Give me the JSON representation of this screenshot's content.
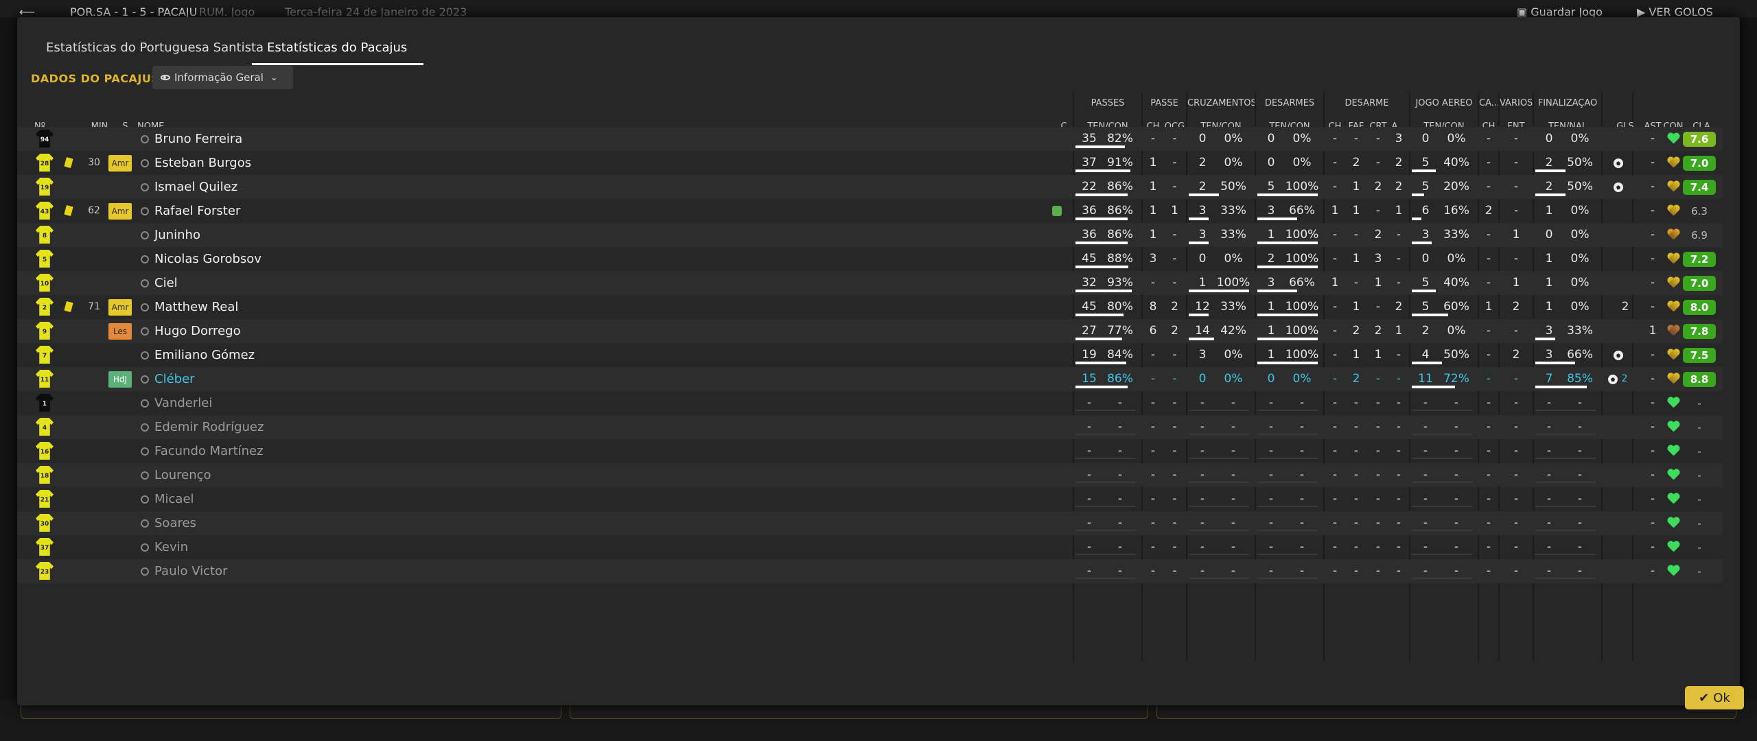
{
  "background": {
    "match_info": "POR.SA - 1 - 5 - PACAJU",
    "match_extra": "RUM. Jogo",
    "date": "Terça-feira 24 de Janeiro de 2023",
    "save_label": "Guardar Jogo",
    "view_label": "VER GOLOS"
  },
  "tabs": [
    {
      "label": "Estatísticas do Portuguesa Santista",
      "active": false
    },
    {
      "label": "Estatísticas do Pacajus",
      "active": true
    }
  ],
  "team_label": "DADOS DO PACAJUS",
  "view_dropdown": {
    "label": "Informação Geral"
  },
  "group_headers": {
    "passes": "PASSES",
    "passe": "PASSE",
    "cruzamentos": "CRUZAMENTOS",
    "desarmes": "DESARMES",
    "desarme": "DESARME",
    "jogo_aereo": "JOGO AÉREO",
    "ca": "CA...",
    "varios": "VÁRIOS",
    "finalizacao": "FINALIZAÇÃO"
  },
  "columns": {
    "num": "Nº",
    "min": "MIN",
    "s": "S",
    "nome": "NOME",
    "c": "C",
    "passes": "TEN/CON",
    "passe_ch": "CH",
    "passe_ocg": "OCG",
    "cruz": "TEN/CON",
    "desarmes": "TEN/CON",
    "des_ch": "CH",
    "des_faf": "FAF",
    "des_crt": "CRT",
    "des_a": "A...",
    "aereo": "TEN/CON",
    "ca_ch": "CH",
    "fnt": "FNT",
    "fin": "TEN/NAL",
    "gls": "GLS",
    "ast": "AST",
    "con": "CON",
    "cla": "CLA"
  },
  "colors": {
    "accent": "#e0b52b",
    "highlight": "#3ec6e8",
    "rating_green": "#3aa71e"
  },
  "players": [
    {
      "num": "94",
      "gk": true,
      "card": false,
      "min": "",
      "badge": "",
      "name": "Bruno Ferreira",
      "sub": false,
      "pass": [
        "35",
        "82%",
        0.82
      ],
      "pch": "-",
      "pocg": "-",
      "cruz": [
        "0",
        "0%",
        0
      ],
      "des": [
        "0",
        "0%",
        0
      ],
      "dch": "-",
      "faf": "-",
      "crt": "-",
      "da": "3",
      "aer": [
        "0",
        "0%",
        0
      ],
      "cach": "-",
      "fnt": "-",
      "fin": [
        "0",
        "0%",
        0
      ],
      "gls": "",
      "ast": "-",
      "con": "green",
      "cla": "7.6",
      "cla_style": "lg",
      "unused": false,
      "hl": false
    },
    {
      "num": "28",
      "gk": false,
      "card": true,
      "min": "30",
      "badge": "Amr",
      "name": "Esteban Burgos",
      "sub": false,
      "pass": [
        "37",
        "91%",
        0.91
      ],
      "pch": "1",
      "pocg": "-",
      "cruz": [
        "2",
        "0%",
        0
      ],
      "des": [
        "0",
        "0%",
        0
      ],
      "dch": "-",
      "faf": "2",
      "crt": "-",
      "da": "2",
      "aer": [
        "5",
        "40%",
        0.4
      ],
      "cach": "-",
      "fnt": "-",
      "fin": [
        "2",
        "50%",
        0.5
      ],
      "gls": "ball",
      "ast": "-",
      "con": "gold",
      "cla": "7.0",
      "cla_style": "g",
      "unused": false,
      "hl": false
    },
    {
      "num": "19",
      "gk": false,
      "card": false,
      "min": "",
      "badge": "",
      "name": "Ismael Quilez",
      "sub": false,
      "pass": [
        "22",
        "86%",
        0.86
      ],
      "pch": "1",
      "pocg": "-",
      "cruz": [
        "2",
        "50%",
        0.5
      ],
      "des": [
        "5",
        "100%",
        1
      ],
      "dch": "-",
      "faf": "1",
      "crt": "2",
      "da": "2",
      "aer": [
        "5",
        "20%",
        0.2
      ],
      "cach": "-",
      "fnt": "-",
      "fin": [
        "2",
        "50%",
        0.5
      ],
      "gls": "ball",
      "ast": "-",
      "con": "gold",
      "cla": "7.4",
      "cla_style": "g",
      "unused": false,
      "hl": false
    },
    {
      "num": "43",
      "gk": false,
      "card": true,
      "min": "62",
      "badge": "Amr",
      "name": "Rafael Forster",
      "sub": true,
      "pass": [
        "36",
        "86%",
        0.86
      ],
      "pch": "1",
      "pocg": "1",
      "cruz": [
        "3",
        "33%",
        0.33
      ],
      "des": [
        "3",
        "66%",
        0.66
      ],
      "dch": "1",
      "faf": "1",
      "crt": "-",
      "da": "1",
      "aer": [
        "6",
        "16%",
        0.16
      ],
      "cach": "2",
      "fnt": "-",
      "fin": [
        "1",
        "0%",
        0
      ],
      "gls": "",
      "ast": "-",
      "con": "gold",
      "cla": "6.3",
      "cla_style": "n",
      "unused": false,
      "hl": false
    },
    {
      "num": "8",
      "gk": false,
      "card": false,
      "min": "",
      "badge": "",
      "name": "Juninho",
      "sub": false,
      "pass": [
        "36",
        "86%",
        0.86
      ],
      "pch": "1",
      "pocg": "-",
      "cruz": [
        "3",
        "33%",
        0.33
      ],
      "des": [
        "1",
        "100%",
        1
      ],
      "dch": "-",
      "faf": "-",
      "crt": "2",
      "da": "-",
      "aer": [
        "3",
        "33%",
        0.33
      ],
      "cach": "-",
      "fnt": "1",
      "fin": [
        "0",
        "0%",
        0
      ],
      "gls": "",
      "ast": "-",
      "con": "orange",
      "cla": "6.9",
      "cla_style": "n",
      "unused": false,
      "hl": false
    },
    {
      "num": "5",
      "gk": false,
      "card": false,
      "min": "",
      "badge": "",
      "name": "Nicolas Gorobsov",
      "sub": false,
      "pass": [
        "45",
        "88%",
        0.88
      ],
      "pch": "3",
      "pocg": "-",
      "cruz": [
        "0",
        "0%",
        0
      ],
      "des": [
        "2",
        "100%",
        1
      ],
      "dch": "-",
      "faf": "1",
      "crt": "3",
      "da": "-",
      "aer": [
        "0",
        "0%",
        0
      ],
      "cach": "-",
      "fnt": "-",
      "fin": [
        "1",
        "0%",
        0
      ],
      "gls": "",
      "ast": "-",
      "con": "gold",
      "cla": "7.2",
      "cla_style": "g",
      "unused": false,
      "hl": false
    },
    {
      "num": "10",
      "gk": false,
      "card": false,
      "min": "",
      "badge": "",
      "name": "Ciel",
      "sub": false,
      "pass": [
        "32",
        "93%",
        0.93
      ],
      "pch": "-",
      "pocg": "-",
      "cruz": [
        "1",
        "100%",
        1
      ],
      "des": [
        "3",
        "66%",
        0.66
      ],
      "dch": "1",
      "faf": "-",
      "crt": "1",
      "da": "-",
      "aer": [
        "5",
        "40%",
        0.4
      ],
      "cach": "-",
      "fnt": "1",
      "fin": [
        "1",
        "0%",
        0
      ],
      "gls": "",
      "ast": "-",
      "con": "gold",
      "cla": "7.0",
      "cla_style": "g",
      "unused": false,
      "hl": false
    },
    {
      "num": "2",
      "gk": false,
      "card": true,
      "min": "71",
      "badge": "Amr",
      "name": "Matthew Real",
      "sub": false,
      "pass": [
        "45",
        "80%",
        0.8
      ],
      "pch": "8",
      "pocg": "2",
      "cruz": [
        "12",
        "33%",
        0.33
      ],
      "des": [
        "1",
        "100%",
        1
      ],
      "dch": "-",
      "faf": "1",
      "crt": "-",
      "da": "2",
      "aer": [
        "5",
        "60%",
        0.6
      ],
      "cach": "1",
      "fnt": "2",
      "fin": [
        "1",
        "0%",
        0
      ],
      "gls": "2",
      "ast": "-",
      "con": "gold",
      "cla": "8.0",
      "cla_style": "g",
      "unused": false,
      "hl": false
    },
    {
      "num": "9",
      "gk": false,
      "card": false,
      "min": "",
      "badge": "Les",
      "name": "Hugo Dorrego",
      "sub": false,
      "pass": [
        "27",
        "77%",
        0.77
      ],
      "pch": "6",
      "pocg": "2",
      "cruz": [
        "14",
        "42%",
        0.42
      ],
      "des": [
        "1",
        "100%",
        1
      ],
      "dch": "-",
      "faf": "2",
      "crt": "2",
      "da": "1",
      "aer": [
        "2",
        "0%",
        0
      ],
      "cach": "-",
      "fnt": "-",
      "fin": [
        "3",
        "33%",
        0.33
      ],
      "gls": "",
      "ast": "1",
      "con": "brown",
      "cla": "7.8",
      "cla_style": "g",
      "unused": false,
      "hl": false
    },
    {
      "num": "7",
      "gk": false,
      "card": false,
      "min": "",
      "badge": "",
      "name": "Emiliano Gómez",
      "sub": false,
      "pass": [
        "19",
        "84%",
        0.84
      ],
      "pch": "-",
      "pocg": "-",
      "cruz": [
        "3",
        "0%",
        0
      ],
      "des": [
        "1",
        "100%",
        1
      ],
      "dch": "-",
      "faf": "1",
      "crt": "1",
      "da": "-",
      "aer": [
        "4",
        "50%",
        0.5
      ],
      "cach": "-",
      "fnt": "2",
      "fin": [
        "3",
        "66%",
        0.66
      ],
      "gls": "ball",
      "ast": "-",
      "con": "gold",
      "cla": "7.5",
      "cla_style": "g",
      "unused": false,
      "hl": false
    },
    {
      "num": "11",
      "gk": false,
      "card": false,
      "min": "",
      "badge": "HdJ",
      "name": "Cléber",
      "sub": false,
      "pass": [
        "15",
        "86%",
        0.86
      ],
      "pch": "-",
      "pocg": "-",
      "cruz": [
        "0",
        "0%",
        0
      ],
      "des": [
        "0",
        "0%",
        0
      ],
      "dch": "-",
      "faf": "2",
      "crt": "-",
      "da": "-",
      "aer": [
        "11",
        "72%",
        0.72
      ],
      "cach": "-",
      "fnt": "-",
      "fin": [
        "7",
        "85%",
        0.85
      ],
      "gls": "ball2",
      "ast": "-",
      "con": "gold",
      "cla": "8.8",
      "cla_style": "g",
      "unused": false,
      "hl": true
    },
    {
      "num": "1",
      "gk": true,
      "card": false,
      "min": "",
      "badge": "",
      "name": "Vanderlei",
      "unused": true,
      "con": "green"
    },
    {
      "num": "4",
      "gk": false,
      "card": false,
      "min": "",
      "badge": "",
      "name": "Edemir Rodríguez",
      "unused": true,
      "con": "green"
    },
    {
      "num": "16",
      "gk": false,
      "card": false,
      "min": "",
      "badge": "",
      "name": "Facundo Martínez",
      "unused": true,
      "con": "green"
    },
    {
      "num": "18",
      "gk": false,
      "card": false,
      "min": "",
      "badge": "",
      "name": "Lourenço",
      "unused": true,
      "con": "green"
    },
    {
      "num": "21",
      "gk": false,
      "card": false,
      "min": "",
      "badge": "",
      "name": "Micael",
      "unused": true,
      "con": "green"
    },
    {
      "num": "30",
      "gk": false,
      "card": false,
      "min": "",
      "badge": "",
      "name": "Soares",
      "unused": true,
      "con": "green"
    },
    {
      "num": "37",
      "gk": false,
      "card": false,
      "min": "",
      "badge": "",
      "name": "Kevin",
      "unused": true,
      "con": "green"
    },
    {
      "num": "23",
      "gk": false,
      "card": false,
      "min": "",
      "badge": "",
      "name": "Paulo Victor",
      "unused": true,
      "con": "green"
    }
  ],
  "ok_label": "Ok",
  "gls_extra": "2"
}
